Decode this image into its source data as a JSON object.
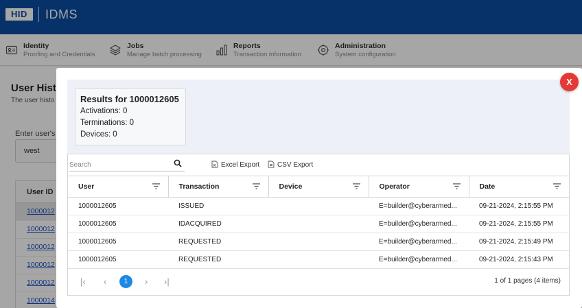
{
  "header": {
    "brand": "HID",
    "app_name": "IDMS"
  },
  "nav": [
    {
      "title": "Identity",
      "subtitle": "Proofing and Credentials",
      "icon": "id-card-icon"
    },
    {
      "title": "Jobs",
      "subtitle": "Manage batch processing",
      "icon": "layers-icon"
    },
    {
      "title": "Reports",
      "subtitle": "Transaction information",
      "icon": "bar-chart-icon"
    },
    {
      "title": "Administration",
      "subtitle": "System configuration",
      "icon": "gear-icon"
    }
  ],
  "background": {
    "title": "User Histo",
    "description": "The user histo",
    "input_label": "Enter user's",
    "input_value": "west",
    "table_header": "User ID",
    "user_ids": [
      "1000012",
      "1000012",
      "1000012",
      "1000012",
      "1000012",
      "1000014"
    ]
  },
  "modal": {
    "close_label": "X",
    "results": {
      "title": "Results for 1000012605",
      "activations": "Activations: 0",
      "terminations": "Terminations: 0",
      "devices": "Devices: 0"
    },
    "toolbar": {
      "search_placeholder": "Search",
      "excel_export": "Excel Export",
      "csv_export": "CSV Export"
    },
    "columns": [
      "User",
      "Transaction",
      "Device",
      "Operator",
      "Date"
    ],
    "rows": [
      {
        "user": "1000012605",
        "transaction": "ISSUED",
        "device": "",
        "operator": "E=builder@cyberarmed...",
        "date": "09-21-2024, 2:15:55 PM"
      },
      {
        "user": "1000012605",
        "transaction": "IDACQUIRED",
        "device": "",
        "operator": "E=builder@cyberarmed...",
        "date": "09-21-2024, 2:15:55 PM"
      },
      {
        "user": "1000012605",
        "transaction": "REQUESTED",
        "device": "",
        "operator": "E=builder@cyberarmed...",
        "date": "09-21-2024, 2:15:49 PM"
      },
      {
        "user": "1000012605",
        "transaction": "REQUESTED",
        "device": "",
        "operator": "E=builder@cyberarmed...",
        "date": "09-21-2024, 2:15:43 PM"
      }
    ],
    "pager": {
      "first": "|‹",
      "prev": "‹",
      "current_page": "1",
      "next": "›",
      "last": "›|",
      "info": "1 of 1 pages (4 items)"
    }
  },
  "colors": {
    "header_blue": "#0b4ea2",
    "close_red": "#e53935",
    "page_accent": "#1e88e5"
  }
}
